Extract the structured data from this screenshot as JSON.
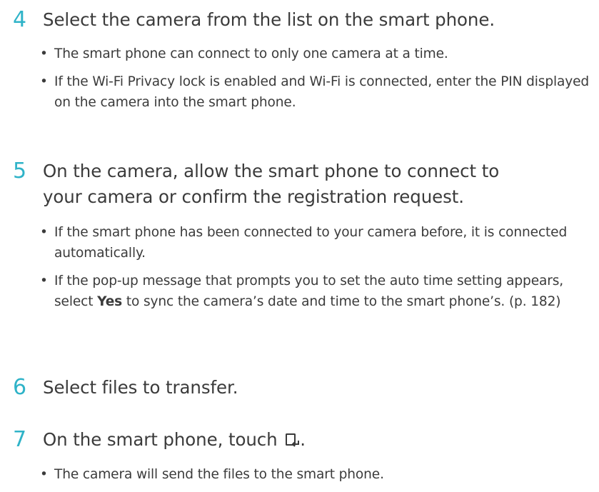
{
  "steps": [
    {
      "number": "4",
      "text": "Select the camera from the list on the smart phone.",
      "bullets": [
        "The smart phone can connect to only one camera at a time.",
        "If the Wi-Fi Privacy lock is enabled and Wi-Fi is connected, enter the PIN displayed on the camera into the smart phone."
      ]
    },
    {
      "number": "5",
      "text": "On the camera, allow the smart phone to connect to your camera or confirm the registration request.",
      "bullets": [
        "If the smart phone has been connected to your camera before, it is connected automatically.",
        {
          "before": "If the pop-up message that prompts you to set the auto time setting appears, select ",
          "bold": "Yes",
          "after": " to sync the camera’s date and time to the smart phone’s. (p. 182)"
        }
      ]
    },
    {
      "number": "6",
      "text": "Select files to transfer."
    },
    {
      "number": "7",
      "text": "On the smart phone, touch",
      "text_end": ".",
      "icon": "send-to-phone-icon",
      "bullets": [
        "The camera will send the files to the smart phone."
      ]
    }
  ],
  "colors": {
    "step_number": "#2fb3c8",
    "text": "#3b3b3b"
  }
}
